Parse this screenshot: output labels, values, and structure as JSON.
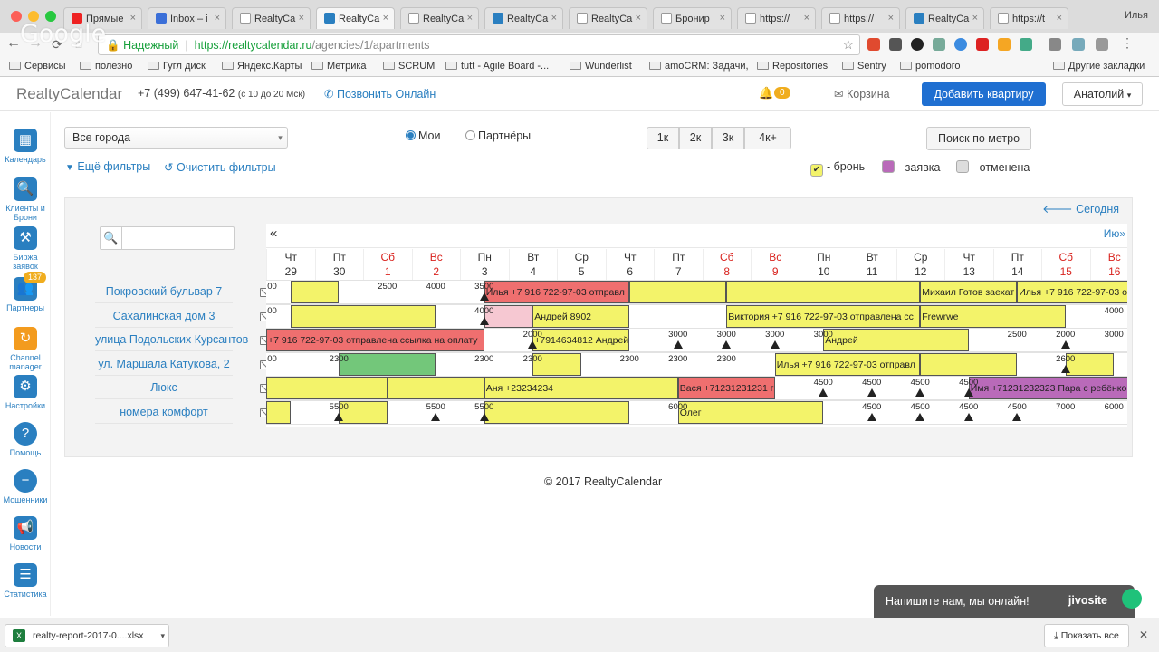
{
  "browser": {
    "tabs": [
      {
        "label": "Прямые",
        "icon": "youtube-icon",
        "color": "#e22"
      },
      {
        "label": "Inbox – i",
        "icon": "mail-icon",
        "color": "#3b6fd8"
      },
      {
        "label": "RealtyCa",
        "icon": "page-icon",
        "color": "#fff"
      },
      {
        "label": "RealtyCa",
        "icon": "realty-icon",
        "color": "#2a7fc0",
        "active": true
      },
      {
        "label": "RealtyCa",
        "icon": "page-icon",
        "color": "#fff"
      },
      {
        "label": "RealtyCa",
        "icon": "realty-icon",
        "color": "#2a7fc0"
      },
      {
        "label": "RealtyCa",
        "icon": "page-icon",
        "color": "#fff"
      },
      {
        "label": "Бронир",
        "icon": "page-icon",
        "color": "#fff"
      },
      {
        "label": "https://",
        "icon": "page-icon",
        "color": "#fff"
      },
      {
        "label": "https://",
        "icon": "page-icon",
        "color": "#fff"
      },
      {
        "label": "RealtyCa",
        "icon": "realty-icon",
        "color": "#2a7fc0"
      },
      {
        "label": "https://t",
        "icon": "page-icon",
        "color": "#fff"
      }
    ],
    "user_name": "Илья",
    "watermark": "Google",
    "secure_label": "Надежный",
    "url_base": "https://realtycalendar.ru",
    "url_path": "/agencies/1/apartments",
    "bookmarks": [
      "Сервисы",
      "полезно",
      "Гугл диск",
      "Яндекс.Карты",
      "Метрика",
      "SCRUM",
      "tutt - Agile Board -...",
      "Wunderlist",
      "amoCRM: Задачи,",
      "Repositories",
      "Sentry",
      "pomodoro",
      "Другие закладки"
    ]
  },
  "header": {
    "logo": "RealtyCalendar",
    "phone": "+7 (499) 647-41-62",
    "phone_hours": "(с 10 до 20 Мск)",
    "call_online": "Позвонить Онлайн",
    "notifications_count": "0",
    "cart": "Корзина",
    "add_apartment": "Добавить квартиру",
    "user_menu": "Анатолий"
  },
  "sidebar": [
    {
      "label": "Календарь",
      "icon": "calendar-icon"
    },
    {
      "label": "Клиенты и Брони",
      "icon": "clients-icon"
    },
    {
      "label": "Биржа заявок",
      "icon": "auction-icon"
    },
    {
      "label": "Партнеры",
      "icon": "partners-icon",
      "badge": "137"
    },
    {
      "label": "Channel manager",
      "icon": "channel-manager-icon"
    },
    {
      "label": "Настройки",
      "icon": "settings-icon"
    },
    {
      "label": "Помощь",
      "icon": "help-icon"
    },
    {
      "label": "Мошенники",
      "icon": "fraud-icon"
    },
    {
      "label": "Новости",
      "icon": "news-icon"
    },
    {
      "label": "Статистика",
      "icon": "statistics-icon"
    }
  ],
  "filters": {
    "city_select": "Все города",
    "radio_mine": "Мои",
    "radio_partners": "Партнёры",
    "room_buttons": [
      "1к",
      "2к",
      "3к",
      "4к+"
    ],
    "metro_search": "Поиск по метро",
    "more_filters": "Ещё фильтры",
    "clear_filters": "Очистить фильтры",
    "legend": [
      {
        "label": "- бронь",
        "color": "#f3f36a"
      },
      {
        "label": "- заявка",
        "color": "#b96ab9"
      },
      {
        "label": "- отменена",
        "color": "#dddddd"
      }
    ]
  },
  "calendar": {
    "today": "Сегодня",
    "next_month": "Ию",
    "days": [
      {
        "dow": "Чт",
        "num": "29"
      },
      {
        "dow": "Пт",
        "num": "30"
      },
      {
        "dow": "Сб",
        "num": "1",
        "weekend": true
      },
      {
        "dow": "Вс",
        "num": "2",
        "weekend": true
      },
      {
        "dow": "Пн",
        "num": "3"
      },
      {
        "dow": "Вт",
        "num": "4"
      },
      {
        "dow": "Ср",
        "num": "5"
      },
      {
        "dow": "Чт",
        "num": "6"
      },
      {
        "dow": "Пт",
        "num": "7"
      },
      {
        "dow": "Сб",
        "num": "8",
        "weekend": true
      },
      {
        "dow": "Вс",
        "num": "9",
        "weekend": true
      },
      {
        "dow": "Пн",
        "num": "10"
      },
      {
        "dow": "Вт",
        "num": "11"
      },
      {
        "dow": "Ср",
        "num": "12"
      },
      {
        "dow": "Чт",
        "num": "13"
      },
      {
        "dow": "Пт",
        "num": "14"
      },
      {
        "dow": "Сб",
        "num": "15",
        "weekend": true
      },
      {
        "dow": "Вс",
        "num": "16",
        "weekend": true
      }
    ],
    "apartments": [
      {
        "name": "Покровский бульвар 7",
        "bookings": [
          {
            "from": 0.5,
            "to": 1.5,
            "color": "y",
            "text": ""
          },
          {
            "from": 4.5,
            "to": 7.5,
            "color": "r",
            "text": "Илья +7 916 722-97-03 отправл"
          },
          {
            "from": 7.5,
            "to": 9.5,
            "color": "y",
            "text": ""
          },
          {
            "from": 9.5,
            "to": 13.5,
            "color": "y",
            "text": ""
          },
          {
            "from": 13.5,
            "to": 15.5,
            "color": "y",
            "text": "Михаил Готов заехат"
          },
          {
            "from": 15.5,
            "to": 18,
            "color": "y",
            "text": "Илья +7 916 722-97-03 о"
          }
        ],
        "prices": [
          {
            "day": 0,
            "value": "00"
          },
          {
            "day": 2,
            "value": "2500"
          },
          {
            "day": 3,
            "value": "4000"
          },
          {
            "day": 4,
            "value": "3500",
            "warn": true
          }
        ]
      },
      {
        "name": "Сахалинская дом 3",
        "bookings": [
          {
            "from": 0.5,
            "to": 3.5,
            "color": "y",
            "text": ""
          },
          {
            "from": 4.5,
            "to": 5.5,
            "color": "p",
            "text": ""
          },
          {
            "from": 5.5,
            "to": 7.5,
            "color": "y",
            "text": "Андрей 8902"
          },
          {
            "from": 9.5,
            "to": 13.5,
            "color": "y",
            "text": "Виктория +7 916 722-97-03 отправлена сс"
          },
          {
            "from": 13.5,
            "to": 16.5,
            "color": "y",
            "text": "Frewrwe"
          }
        ],
        "prices": [
          {
            "day": 0,
            "value": "00"
          },
          {
            "day": 4,
            "value": "4000",
            "warn": true
          },
          {
            "day": 17,
            "value": "4000"
          }
        ]
      },
      {
        "name": "улица Подольских Курсантов",
        "bookings": [
          {
            "from": 0,
            "to": 4.5,
            "color": "r",
            "text": "+7 916 722-97-03 отправлена ссылка на оплату"
          },
          {
            "from": 5.5,
            "to": 7.5,
            "color": "y",
            "text": "+7914634812 Андрей"
          },
          {
            "from": 11.5,
            "to": 14.5,
            "color": "y",
            "text": "Андрей"
          }
        ],
        "prices": [
          {
            "day": 5,
            "value": "2000",
            "warn": true
          },
          {
            "day": 8,
            "value": "3000",
            "warn": true
          },
          {
            "day": 9,
            "value": "3000",
            "warn": true
          },
          {
            "day": 10,
            "value": "3000",
            "warn": true
          },
          {
            "day": 11,
            "value": "3000"
          },
          {
            "day": 15,
            "value": "2500"
          },
          {
            "day": 16,
            "value": "2000",
            "warn": true
          },
          {
            "day": 17,
            "value": "3000"
          }
        ]
      },
      {
        "name": "ул. Маршала Катукова, 2",
        "bookings": [
          {
            "from": 1.5,
            "to": 3.5,
            "color": "g",
            "text": ""
          },
          {
            "from": 5.5,
            "to": 6.5,
            "color": "y",
            "text": ""
          },
          {
            "from": 10.5,
            "to": 13.5,
            "color": "y",
            "text": "Илья +7 916 722-97-03 отправл"
          },
          {
            "from": 13.5,
            "to": 15.5,
            "color": "y",
            "text": ""
          },
          {
            "from": 16.5,
            "to": 17.5,
            "color": "y",
            "text": ""
          }
        ],
        "prices": [
          {
            "day": 0,
            "value": "00"
          },
          {
            "day": 1,
            "value": "2300"
          },
          {
            "day": 4,
            "value": "2300"
          },
          {
            "day": 5,
            "value": "2300"
          },
          {
            "day": 7,
            "value": "2300"
          },
          {
            "day": 8,
            "value": "2300"
          },
          {
            "day": 9,
            "value": "2300"
          },
          {
            "day": 16,
            "value": "2600",
            "warn": true
          }
        ]
      },
      {
        "name": "Люкс",
        "bookings": [
          {
            "from": 0,
            "to": 2.5,
            "color": "y",
            "text": ""
          },
          {
            "from": 2.5,
            "to": 4.5,
            "color": "y",
            "text": ""
          },
          {
            "from": 4.5,
            "to": 8.5,
            "color": "y",
            "text": "Аня +23234234"
          },
          {
            "from": 8.5,
            "to": 10.5,
            "color": "r",
            "text": "Вася +71231231231 г"
          },
          {
            "from": 14.5,
            "to": 18,
            "color": "v",
            "text": "Имя +71231232323 Пара с ребёнко"
          }
        ],
        "prices": [
          {
            "day": 11,
            "value": "4500",
            "warn": true
          },
          {
            "day": 12,
            "value": "4500",
            "warn": true
          },
          {
            "day": 13,
            "value": "4500",
            "warn": true
          },
          {
            "day": 14,
            "value": "4500",
            "warn": true
          }
        ]
      },
      {
        "name": "номера комфорт",
        "bookings": [
          {
            "from": 0,
            "to": 0.5,
            "color": "y",
            "text": ""
          },
          {
            "from": 1.5,
            "to": 2.5,
            "color": "y",
            "text": ""
          },
          {
            "from": 4.5,
            "to": 7.5,
            "color": "y",
            "text": ""
          },
          {
            "from": 8.5,
            "to": 11.5,
            "color": "y",
            "text": "Олег"
          }
        ],
        "prices": [
          {
            "day": 1,
            "value": "5500",
            "warn": true
          },
          {
            "day": 3,
            "value": "5500",
            "warn": true
          },
          {
            "day": 4,
            "value": "5500",
            "warn": true
          },
          {
            "day": 8,
            "value": "6000"
          },
          {
            "day": 12,
            "value": "4500",
            "warn": true
          },
          {
            "day": 13,
            "value": "4500",
            "warn": true
          },
          {
            "day": 14,
            "value": "4500",
            "warn": true
          },
          {
            "day": 15,
            "value": "4500",
            "warn": true
          },
          {
            "day": 16,
            "value": "7000"
          },
          {
            "day": 17,
            "value": "6000"
          }
        ]
      }
    ]
  },
  "footer": {
    "copyright": "© 2017 RealtyCalendar"
  },
  "chat_widget": {
    "text": "Напишите нам, мы онлайн!",
    "brand": "jivosite"
  },
  "downloads": {
    "file": "realty-report-2017-0....xlsx",
    "show_all": "Показать все"
  }
}
